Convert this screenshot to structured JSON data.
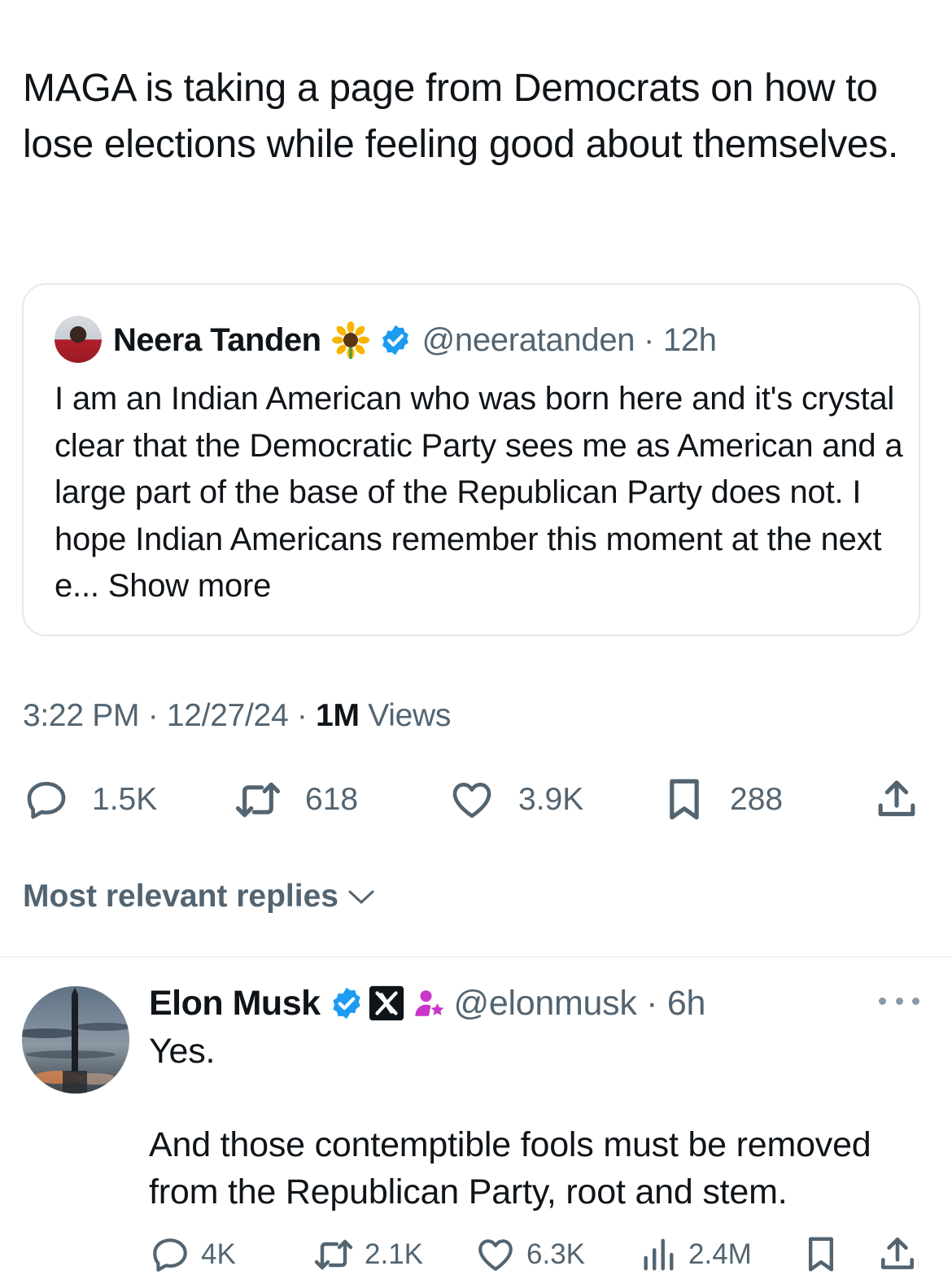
{
  "tweet": {
    "text": "MAGA is taking a page from Democrats on how to lose elections while feeling good about themselves."
  },
  "quote": {
    "name": "Neera Tanden",
    "handle": "@neeratanden",
    "time": "12h",
    "text": "I am an Indian American who was born here and it's crystal clear that the Democratic Party sees me as American and a large part of the base of the Republican Party does not. I hope Indian Americans remember this moment at the next e...",
    "show_more": "Show more"
  },
  "meta": {
    "time": "3:22 PM",
    "date": "12/27/24",
    "views_count": "1M",
    "views_label": "Views"
  },
  "actions": {
    "replies": "1.5K",
    "reposts": "618",
    "likes": "3.9K",
    "bookmarks": "288"
  },
  "replies_header": {
    "label": "Most relevant replies"
  },
  "reply": {
    "name": "Elon Musk",
    "handle": "@elonmusk",
    "time": "6h",
    "text": "Yes.\n\nAnd those contemptible fools must be removed from the Republican Party, root and stem.",
    "actions": {
      "replies": "4K",
      "reposts": "2.1K",
      "likes": "6.3K",
      "views": "2.4M"
    }
  },
  "colors": {
    "text": "#0f1419",
    "secondary": "#536471",
    "verified": "#1d9bf0",
    "border": "#e6e9eb",
    "subscriber_badge": "#c936c9"
  },
  "icons": {
    "verified": "verified-badge-icon",
    "sunflower": "sunflower-icon",
    "x_logo": "x-logo-icon",
    "subscriber": "subscriber-star-icon",
    "reply": "reply-icon",
    "repost": "repost-icon",
    "like": "heart-icon",
    "bookmark": "bookmark-icon",
    "share": "share-icon",
    "views": "views-icon",
    "more": "more-icon",
    "chevron": "chevron-down-icon"
  }
}
